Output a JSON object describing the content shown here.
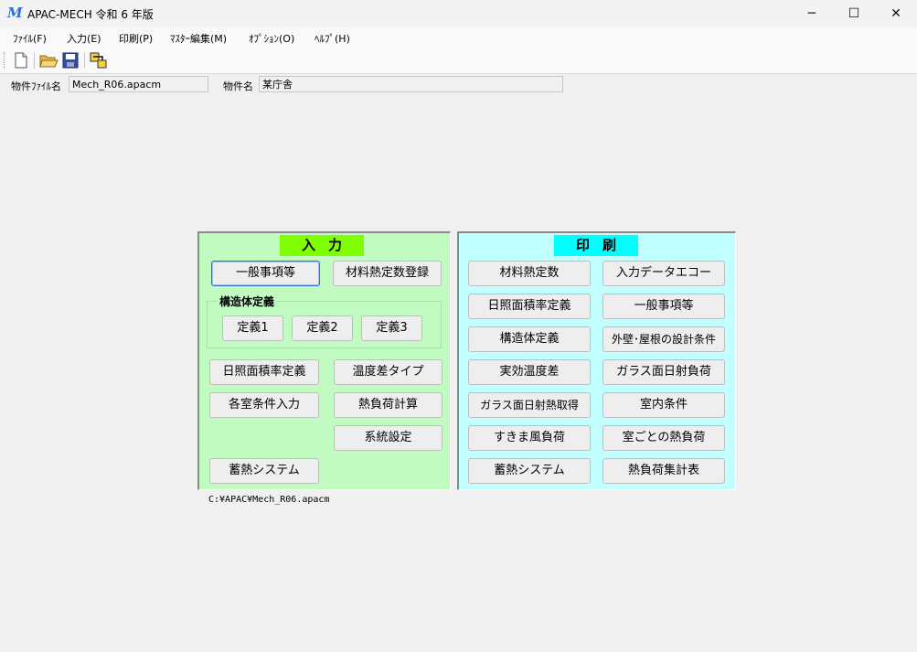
{
  "window": {
    "title": "APAC-MECH 令和 6 年版",
    "app_icon": "M",
    "controls": {
      "minimize": "─",
      "maximize": "☐",
      "close": "✕"
    }
  },
  "menu": [
    "ﾌｧｲﾙ(F)",
    "入力(E)",
    "印刷(P)",
    "ﾏｽﾀｰ編集(M)",
    "ｵﾌﾟｼｮﾝ(O)",
    "ﾍﾙﾌﾟ(H)"
  ],
  "toolbar": {
    "icons": [
      "new-file-icon",
      "open-folder-icon",
      "save-disk-icon",
      "run-icon"
    ]
  },
  "info": {
    "file_label": "物件ﾌｧｲﾙ名",
    "file_value": "Mech_R06.apacm",
    "name_label": "物件名",
    "name_value": "某庁舎"
  },
  "input_panel": {
    "title": "入力",
    "color": "#c2fbc2",
    "title_color": "#80ff00",
    "buttons": {
      "general": "一般事項等",
      "material": "材料熱定数登録",
      "structure_group": "構造体定義",
      "def1": "定義1",
      "def2": "定義2",
      "def3": "定義3",
      "sunlit": "日照面積率定義",
      "temp_type": "温度差タイプ",
      "room_cond": "各室条件入力",
      "heat_calc": "熱負荷計算",
      "system": "系統設定",
      "storage": "蓄熱システム"
    }
  },
  "print_panel": {
    "title": "印刷",
    "color": "#c2ffff",
    "title_color": "#00ffff",
    "buttons": {
      "material": "材料熱定数",
      "echo": "入力データエコー",
      "sunlit": "日照面積率定義",
      "general": "一般事項等",
      "structure": "構造体定義",
      "wall_roof": "外壁･屋根の設計条件",
      "eff_temp": "実効温度差",
      "glass_solar_load": "ガラス面日射負荷",
      "glass_solar_gain": "ガラス面日射熱取得",
      "indoor": "室内条件",
      "draft": "すきま風負荷",
      "room_load": "室ごとの熱負荷",
      "storage": "蓄熱システム",
      "summary": "熱負荷集計表"
    }
  },
  "path": "C:¥APAC¥Mech_R06.apacm"
}
